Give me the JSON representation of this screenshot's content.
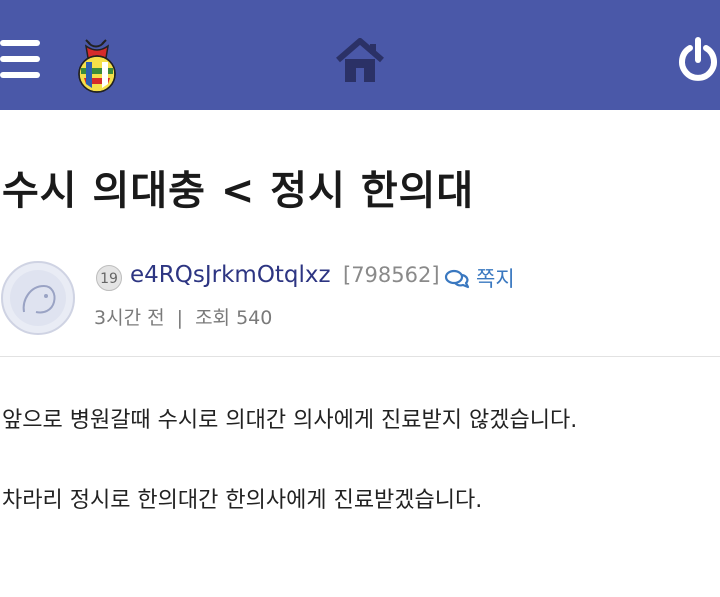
{
  "header": {
    "menu_icon": "hamburger-menu-icon",
    "logo_icon": "pouch-logo-icon",
    "home_icon": "home-icon",
    "power_icon": "power-icon",
    "bar_color": "#4a58a8"
  },
  "post": {
    "title": "수시 의대충 < 정시 한의대",
    "author": {
      "level": "19",
      "name": "e4RQsJrkmOtqlxz",
      "id": "[798562]",
      "message_label": "쪽지"
    },
    "meta": {
      "time": "3시간 전",
      "separator": "|",
      "views_label": "조회",
      "views": "540"
    },
    "body": [
      "앞으로 병원갈때 수시로 의대간 의사에게 진료받지 않겠습니다.",
      "차라리 정시로 한의대간 한의사에게 진료받겠습니다."
    ]
  }
}
